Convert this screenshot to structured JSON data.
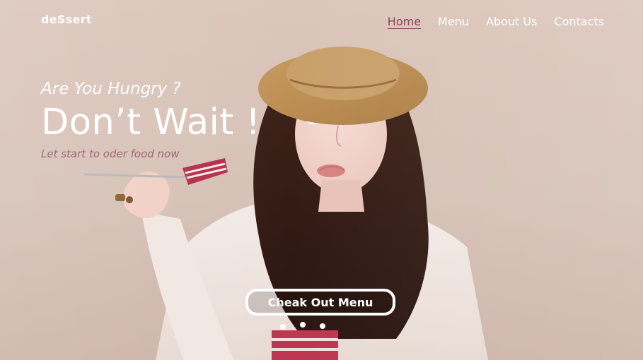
{
  "brand": {
    "logo_text": "deSsert"
  },
  "nav": [
    {
      "label": "Home",
      "active": true
    },
    {
      "label": "Menu",
      "active": false
    },
    {
      "label": "About Us",
      "active": false
    },
    {
      "label": "Contacts",
      "active": false
    }
  ],
  "hero": {
    "kicker": "Are You Hungry ?",
    "headline": "Don’t Wait !",
    "tagline": "Let start to oder food now",
    "cta_label": "Cheak Out Menu"
  },
  "colors": {
    "accent": "#8b3f58",
    "tagline": "#9b5e70"
  }
}
